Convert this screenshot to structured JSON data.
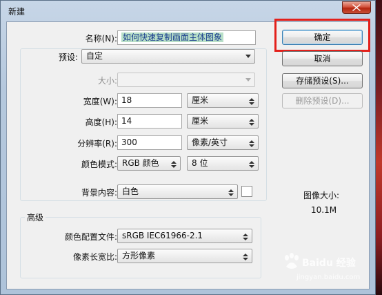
{
  "window": {
    "title": "新建"
  },
  "form": {
    "name_label": "名称(N):",
    "name_value": "如何快速复制画面主体图象",
    "preset_label": "预设:",
    "preset_value": "自定",
    "size_label": "大小:",
    "size_value": "",
    "width_label": "宽度(W):",
    "width_value": "18",
    "width_unit": "厘米",
    "height_label": "高度(H):",
    "height_value": "14",
    "height_unit": "厘米",
    "resolution_label": "分辨率(R):",
    "resolution_value": "300",
    "resolution_unit": "像素/英寸",
    "color_mode_label": "颜色模式:",
    "color_mode_value": "RGB 颜色",
    "bit_depth_value": "8 位",
    "background_label": "背景内容:",
    "background_value": "白色"
  },
  "advanced": {
    "title": "高级",
    "color_profile_label": "颜色配置文件:",
    "color_profile_value": "sRGB IEC61966-2.1",
    "pixel_aspect_label": "像素长宽比:",
    "pixel_aspect_value": "方形像素"
  },
  "buttons": {
    "ok": "确定",
    "cancel": "取消",
    "save_preset": "存储预设(S)...",
    "delete_preset": "删除预设(D)..."
  },
  "image_size": {
    "label": "图像大小:",
    "value": "10.1M"
  },
  "watermark": {
    "brand": "Baidu 经验",
    "url": "jingyan.baidu.com"
  },
  "colors": {
    "highlight": "#e3201b",
    "name_selection": "#b9e0c8",
    "close_button": "#c84d35"
  }
}
